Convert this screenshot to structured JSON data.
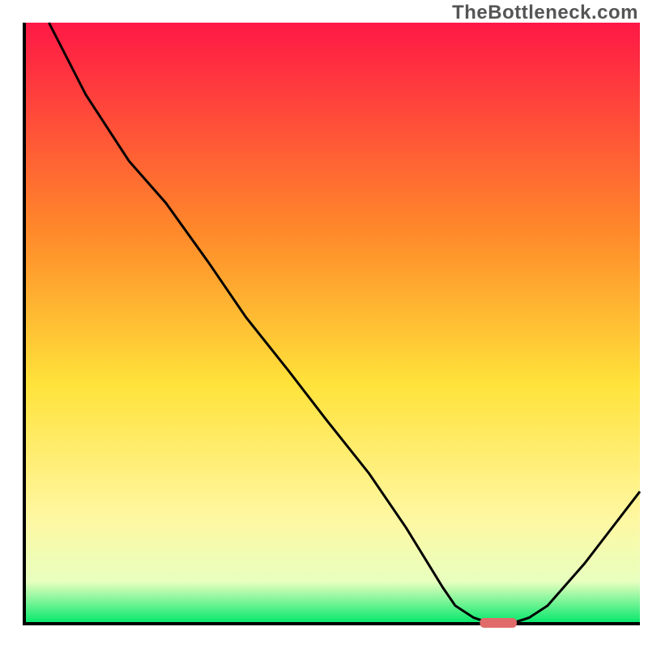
{
  "watermark": "TheBottleneck.com",
  "colors": {
    "curve": "#000000",
    "axis": "#000000",
    "marker": "#e16a6a",
    "gradient_top": "#ff1846",
    "gradient_mid_upper": "#ff8a2a",
    "gradient_mid": "#ffe23a",
    "gradient_mid_lower": "#fff7a0",
    "gradient_near_bottom": "#e8ffbf",
    "gradient_bottom": "#00e86a"
  },
  "chart_data": {
    "type": "line",
    "title": "",
    "xlabel": "",
    "ylabel": "",
    "xlim": [
      0,
      100
    ],
    "ylim": [
      0,
      100
    ],
    "x": [
      4,
      10,
      17,
      23,
      30,
      36,
      43,
      49,
      56,
      62,
      68,
      70,
      73,
      76,
      79,
      82,
      85,
      91,
      100
    ],
    "values": [
      100,
      88,
      77,
      70,
      60,
      51,
      42,
      34,
      25,
      16,
      6,
      3,
      1,
      0,
      0,
      1,
      3,
      10,
      22
    ],
    "flat_marker": {
      "x_start": 74,
      "x_end": 80,
      "y": 0
    },
    "notes": "Values represent relative height of the black curve as a percentage of the plot area (0 = bottom/green, 100 = top/red). Flat marker is the small pink segment at the curve minimum."
  }
}
